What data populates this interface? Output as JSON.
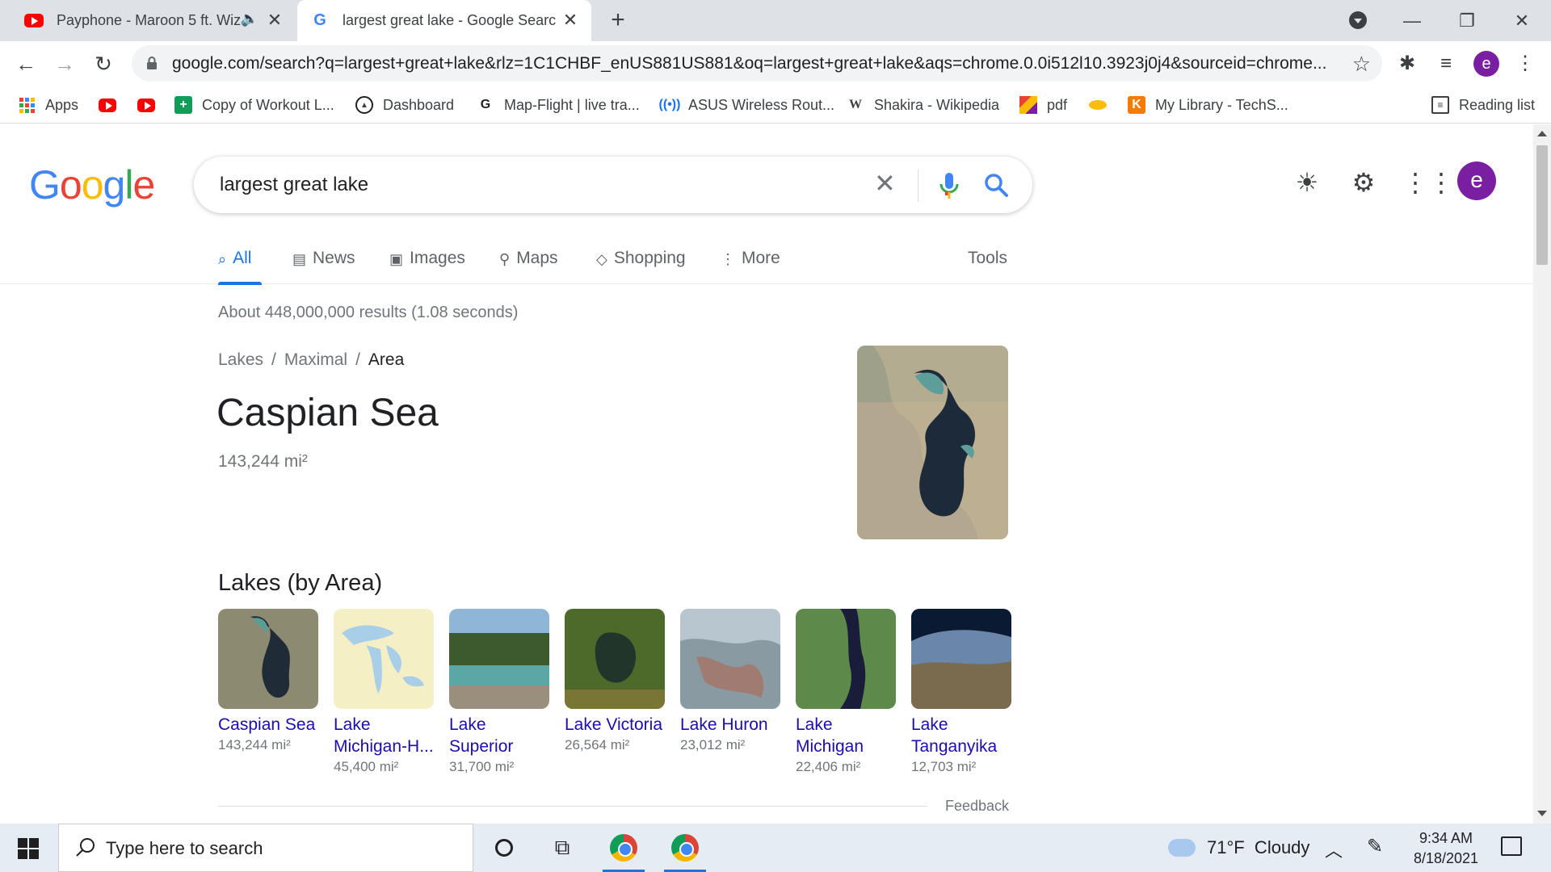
{
  "browser": {
    "tabs": [
      {
        "title": "Payphone - Maroon 5 ft. Wiz",
        "favicon": "youtube-icon",
        "audio": "speaker-icon"
      },
      {
        "title": "largest great lake - Google Search",
        "favicon": "google-icon"
      }
    ],
    "url": "google.com/search?q=largest+great+lake&rlz=1C1CHBF_enUS881US881&oq=largest+great+lake&aqs=chrome.0.0i512l10.3923j0j4&sourceid=chrome...",
    "profile_initial": "e",
    "bookmarks": [
      {
        "label": "Apps",
        "icon": "apps-grid-icon"
      },
      {
        "label": "",
        "icon": "youtube-icon"
      },
      {
        "label": "",
        "icon": "youtube-icon"
      },
      {
        "label": "Copy of Workout L...",
        "icon": "sheets-icon"
      },
      {
        "label": "Dashboard",
        "icon": "dashboard-icon"
      },
      {
        "label": "Map-Flight | live tra...",
        "icon": "flight-icon"
      },
      {
        "label": "ASUS Wireless Rout...",
        "icon": "wireless-icon"
      },
      {
        "label": "Shakira - Wikipedia",
        "icon": "wikipedia-icon"
      },
      {
        "label": "pdf",
        "icon": "pdf-icon"
      },
      {
        "label": "",
        "icon": "bookmark-badge-icon"
      },
      {
        "label": "My Library - TechS...",
        "icon": "techsmith-icon"
      }
    ],
    "reading_list": "Reading list"
  },
  "search": {
    "query": "largest great lake",
    "tabs": [
      "All",
      "News",
      "Images",
      "Maps",
      "Shopping",
      "More"
    ],
    "tools": "Tools",
    "stats": "About 448,000,000 results (1.08 seconds)"
  },
  "answer": {
    "breadcrumb": [
      "Lakes",
      "Maximal",
      "Area"
    ],
    "title": "Caspian Sea",
    "value": "143,244 mi²"
  },
  "lakes": {
    "heading": "Lakes (by Area)",
    "items": [
      {
        "name": "Caspian Sea",
        "area": "143,244 mi²"
      },
      {
        "name": "Lake Michigan-H...",
        "area": "45,400 mi²"
      },
      {
        "name": "Lake Superior",
        "area": "31,700 mi²"
      },
      {
        "name": "Lake Victoria",
        "area": "26,564 mi²"
      },
      {
        "name": "Lake Huron",
        "area": "23,012 mi²"
      },
      {
        "name": "Lake Michigan",
        "area": "22,406 mi²"
      },
      {
        "name": "Lake Tanganyika",
        "area": "12,703 mi²"
      }
    ],
    "feedback": "Feedback"
  },
  "taskbar": {
    "search_placeholder": "Type here to search",
    "weather": "71°F  Cloudy",
    "time": "9:34 AM",
    "date": "8/18/2021"
  },
  "colors": {
    "accent": "#1a73e8",
    "link": "#1a0dab",
    "avatar": "#7b1fa2"
  }
}
